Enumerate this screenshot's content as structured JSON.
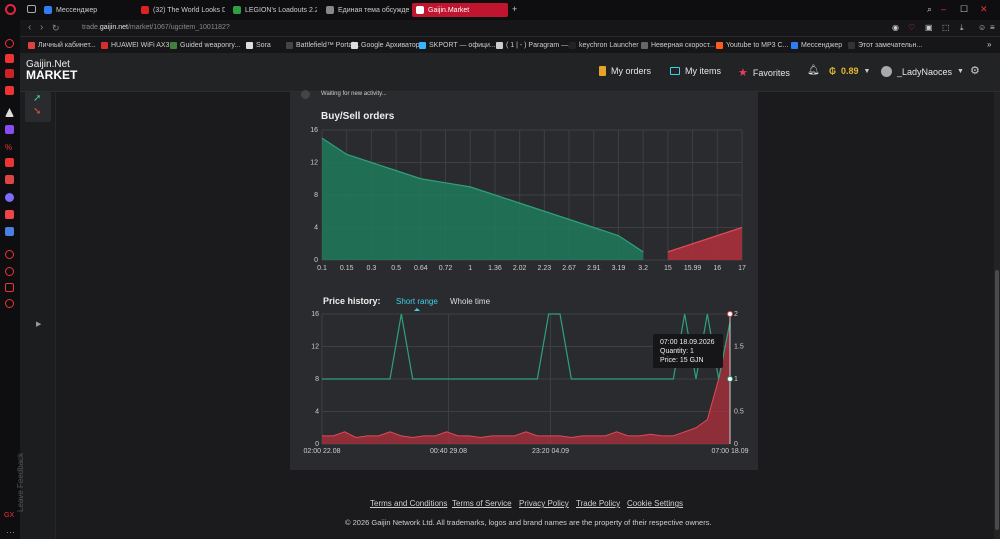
{
  "browser": {
    "tabs": [
      {
        "label": "Мессенджер",
        "color": "#2f7cf6",
        "active": false
      },
      {
        "label": "(32) The World Looks D",
        "color": "#e02121",
        "active": false
      },
      {
        "label": "LEGION's Loadouts 2.26 -",
        "color": "#2f9e44",
        "active": false
      },
      {
        "label": "Единая тема обсуждения",
        "color": "#888888",
        "active": false
      },
      {
        "label": "Gaijin.Market",
        "color": "#ffffff",
        "active": true
      }
    ],
    "new_tab": "+",
    "url_host": "trade.",
    "url_domain": "gaijin.net",
    "url_path": "/market/1067/ugcitem_1001182?",
    "bookmarks": [
      {
        "label": "Личный кабинет...",
        "color": "#e04040"
      },
      {
        "label": "HUAWEI WiFi AX3",
        "color": "#d32f2f"
      },
      {
        "label": "Guided weaponry...",
        "color": "#3f7f3f"
      },
      {
        "label": "Sora",
        "color": "#dddddd"
      },
      {
        "label": "Battlefield™ Portal...",
        "color": "#444444"
      },
      {
        "label": "Google Архиватор",
        "color": "#dddddd"
      },
      {
        "label": "SKPORT — офици...",
        "color": "#39b5ff"
      },
      {
        "label": "( 1 | - ) Paragram —...",
        "color": "#cccccc"
      },
      {
        "label": "keychron Launcher",
        "color": "#222222"
      },
      {
        "label": "Неверная скорост...",
        "color": "#666666"
      },
      {
        "label": "Youtube to MP3 C...",
        "color": "#ff5a1f"
      },
      {
        "label": "Мессенджер",
        "color": "#2f7cf6"
      },
      {
        "label": "Этот замечательн...",
        "color": "#333333"
      }
    ]
  },
  "header": {
    "logo_line1": "Gaijin.Net",
    "logo_line2": "MARKET",
    "my_orders": "My orders",
    "my_items": "My items",
    "favorites": "Favorites",
    "balance": "0.89",
    "username": "_LadyNaoces"
  },
  "activity": {
    "text": "Waiting for new activity..."
  },
  "buy_sell": {
    "title": "Buy/Sell orders"
  },
  "price_history": {
    "title": "Price history:",
    "tab_short": "Short range",
    "tab_whole": "Whole time",
    "tooltip": {
      "time": "07:00 18.09.2026",
      "quantity": "Quantity: 1",
      "price": "Price: 15 GJN"
    }
  },
  "feedback_label": "Leave Feedback",
  "footer": {
    "links": [
      "Terms and Conditions",
      "Terms of Service",
      "Privacy Policy",
      "Trade Policy",
      "Cookie Settings"
    ],
    "copyright": "© 2026 Gaijin Network Ltd. All trademarks, logos and brand names are the property of their respective owners."
  },
  "colors": {
    "accent": "#c0152f",
    "buy": "#1e7a5a",
    "sell": "#b0303c",
    "link": "#3fd0e8"
  },
  "chart_data": [
    {
      "type": "area",
      "title": "Buy/Sell orders",
      "categories": [
        "0.1",
        "0.15",
        "0.3",
        "0.5",
        "0.64",
        "0.72",
        "1",
        "1.36",
        "2.02",
        "2.23",
        "2.67",
        "2.91",
        "3.19",
        "3.2",
        "15",
        "15.99",
        "16",
        "17"
      ],
      "ylim": [
        0,
        16
      ],
      "yticks": [
        "16",
        "12",
        "8",
        "4",
        "0"
      ],
      "series": [
        {
          "name": "buy",
          "values": [
            15,
            13,
            12,
            11,
            10,
            9.5,
            9,
            8,
            7,
            6,
            5,
            4,
            3,
            1,
            null,
            null,
            null,
            null
          ]
        },
        {
          "name": "sell",
          "values": [
            null,
            null,
            null,
            null,
            null,
            null,
            null,
            null,
            null,
            null,
            null,
            null,
            null,
            null,
            1,
            2,
            3,
            4
          ]
        }
      ],
      "grid": true
    },
    {
      "type": "line",
      "title": "Price history:",
      "x_labels": [
        "02:00 22.08",
        "00:40 29.08",
        "23:20 04.09",
        "07:00 18.09"
      ],
      "ylim": [
        0,
        16
      ],
      "yticks": [
        "16",
        "12",
        "8",
        "4",
        "0"
      ],
      "y2lim": [
        0,
        2
      ],
      "y2ticks": [
        "2",
        "1.5",
        "1",
        "0.5",
        "0"
      ],
      "series": [
        {
          "name": "price",
          "values": [
            8,
            8,
            8,
            8,
            8,
            8,
            8,
            16,
            8,
            8,
            8,
            8,
            8,
            8,
            8,
            8,
            8,
            8,
            8,
            8,
            16,
            16,
            8,
            8,
            8,
            8,
            8,
            8,
            8,
            8,
            8,
            8,
            16,
            8,
            16,
            8,
            15
          ]
        },
        {
          "name": "quantity",
          "values": [
            1,
            1,
            1.5,
            0.8,
            1,
            1,
            1.5,
            1,
            0.8,
            1,
            1,
            1.5,
            1,
            1,
            0.8,
            1,
            1,
            1,
            1.5,
            1,
            1,
            1,
            0.8,
            1,
            1,
            1,
            1.5,
            1,
            1,
            1.2,
            1,
            1,
            1.5,
            2,
            3,
            8,
            15
          ]
        }
      ],
      "grid": true
    }
  ]
}
